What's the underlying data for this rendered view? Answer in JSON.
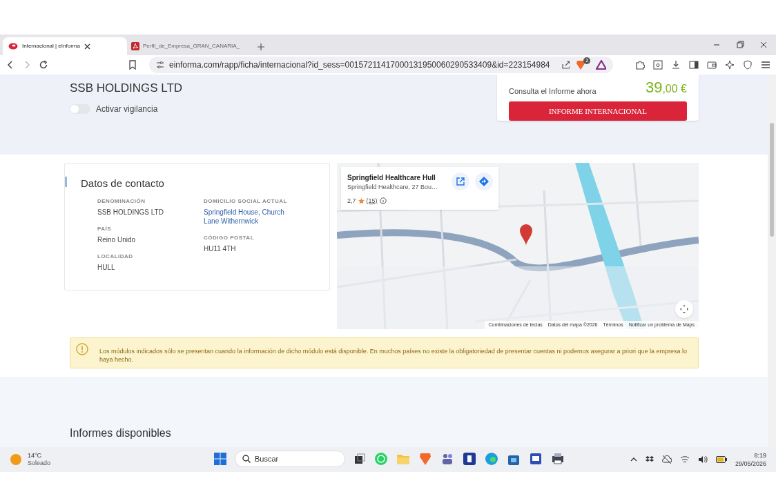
{
  "browser": {
    "tabs": [
      {
        "title": "Internacional | eInforma",
        "selected": true
      },
      {
        "title": "Perfil_de_Empresa_GRAN_CANARIA_",
        "selected": false
      }
    ],
    "url": "einforma.com/rapp/ficha/internacional?id_sess=00157211417000131950060290533409&id=223154984",
    "shield_count": "2"
  },
  "company": {
    "name": "SSB HOLDINGS LTD",
    "watch_label": "Activar vigilancia",
    "watch_on": false
  },
  "offer": {
    "prompt": "Consulta el Informe ahora",
    "price_main": "39",
    "price_cents": ",00 €",
    "button": "INFORME INTERNACIONAL"
  },
  "contact": {
    "title": "Datos de contacto",
    "columns": [
      [
        {
          "label": "DENOMINACIÓN",
          "value": "SSB HOLDINGS LTD",
          "link": false
        },
        {
          "label": "PAÍS",
          "value": "Reino Unido",
          "link": false
        },
        {
          "label": "LOCALIDAD",
          "value": "HULL",
          "link": false
        }
      ],
      [
        {
          "label": "DOMICILIO SOCIAL ACTUAL",
          "value": "Springfield House, Church Lane Withernwick",
          "link": true
        },
        {
          "label": "CÓDIGO POSTAL",
          "value": "HU11 4TH",
          "link": false
        }
      ]
    ]
  },
  "map": {
    "kind": "picture",
    "place": {
      "name": "Springfield Healthcare Hull",
      "address": "Springfield Healthcare, 27 Bou…",
      "rating": "2,7",
      "reviews": "(15)"
    },
    "footer": [
      "Combinaciones de teclas",
      "Datos del mapa ©2026",
      "Términos",
      "Notificar un problema de Maps"
    ]
  },
  "notice": "Los módulos indicados sólo se presentan cuando la información de dicho módulo está disponible. En muchos países no existe la obligatoriedad de presentar cuentas ni podemos asegurar a priori que la empresa lo haya hecho.",
  "section_title": "Informes disponibles",
  "taskbar": {
    "weather": {
      "temp": "14°C",
      "condition": "Soleado"
    },
    "search_placeholder": "Buscar",
    "time": "8:19",
    "date": "29/05/2026"
  }
}
